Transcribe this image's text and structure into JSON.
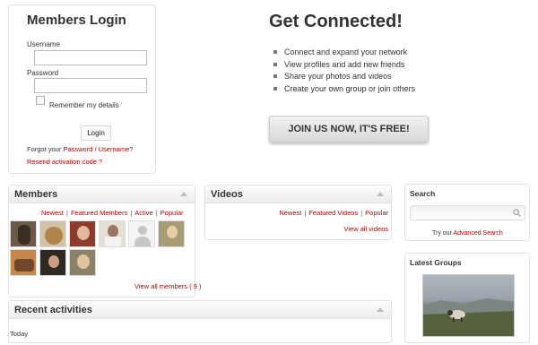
{
  "login": {
    "title": "Members Login",
    "username_label": "Username",
    "username_value": "",
    "password_label": "Password",
    "password_value": "",
    "remember_label": "Remember my details",
    "login_button": "Login",
    "forgot_prefix": "Forgot your ",
    "forgot_password": "Password",
    "forgot_sep": " / ",
    "forgot_username": "Username",
    "forgot_suffix": "?",
    "resend_activation": "Resend activation code ?"
  },
  "promo": {
    "title": "Get Connected!",
    "features": [
      "Connect and expand your network",
      "View profiles and add new friends",
      "Share your photos and videos",
      "Create your own group or join others"
    ],
    "join_button": "JOIN US NOW, IT'S FREE!"
  },
  "members": {
    "title": "Members",
    "tabs": [
      "Newest",
      "Featured Members",
      "Active",
      "Popular"
    ],
    "view_all": "View all members ( 9 )",
    "colors": [
      "#6b5a4a",
      "#b89b6e",
      "#8d3b2b",
      "#d8cfc4",
      "#c9c9c9",
      "#9c8f70",
      "#b77a3d",
      "#3c3028",
      "#8a7a62"
    ]
  },
  "videos": {
    "title": "Videos",
    "tabs": [
      "Newest",
      "Featured Videos",
      "Popular"
    ],
    "view_all": "View all videos"
  },
  "recent": {
    "title": "Recent activities",
    "today_label": "Today"
  },
  "search": {
    "title": "Search",
    "placeholder": "",
    "advanced_prefix": "Try our ",
    "advanced_link": "Advanced Search"
  },
  "groups": {
    "title": "Latest Groups"
  }
}
